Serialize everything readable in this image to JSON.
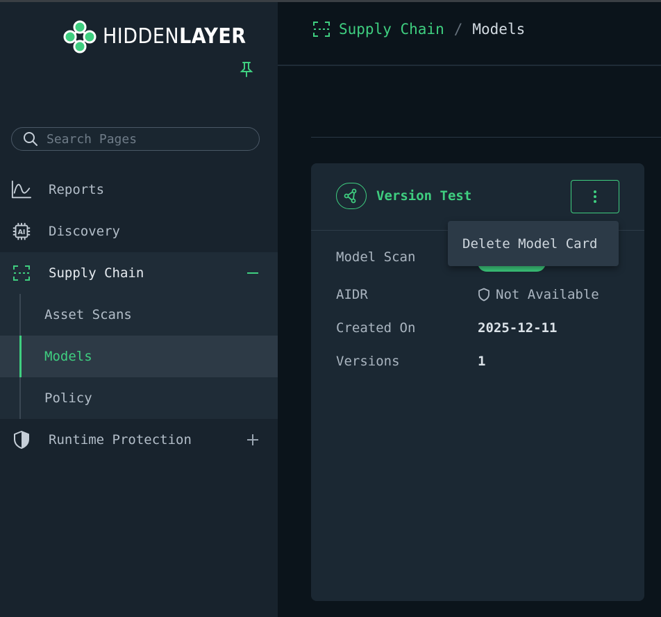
{
  "brand": {
    "logo_light": "HIDDEN",
    "logo_bold": "LAYER",
    "accent": "#3fcf80"
  },
  "search": {
    "placeholder": "Search Pages"
  },
  "sidebar": {
    "items": [
      {
        "label": "Reports",
        "icon": "line-chart-icon"
      },
      {
        "label": "Discovery",
        "icon": "ai-chip-icon"
      },
      {
        "label": "Supply Chain",
        "icon": "scan-frame-icon",
        "expanded": true,
        "children": [
          {
            "label": "Asset Scans"
          },
          {
            "label": "Models",
            "active": true
          },
          {
            "label": "Policy"
          }
        ]
      },
      {
        "label": "Runtime Protection",
        "icon": "shield-icon",
        "expanded": false
      }
    ]
  },
  "breadcrumb": {
    "parent": "Supply Chain",
    "separator": "/",
    "current": "Models"
  },
  "card": {
    "title": "Version Test",
    "rows": [
      {
        "label": "Model Scan",
        "value": ""
      },
      {
        "label": "AIDR",
        "value": "Not Available"
      },
      {
        "label": "Created On",
        "value": "2025-12-11"
      },
      {
        "label": "Versions",
        "value": "1"
      }
    ]
  },
  "menu": {
    "items": [
      "Delete Model Card"
    ]
  }
}
